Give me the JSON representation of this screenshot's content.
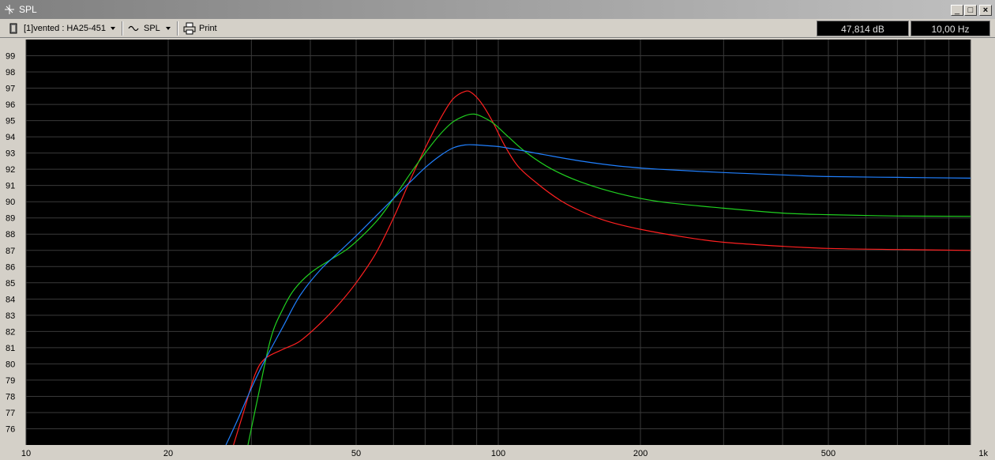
{
  "window": {
    "title": "SPL",
    "min_label": "_",
    "max_label": "□",
    "close_label": "×"
  },
  "toolbar": {
    "project_label": "[1]vented : HA25-451",
    "view_label": "SPL",
    "print_label": "Print",
    "readout_level": "47,814 dB",
    "readout_freq": "10,00 Hz"
  },
  "colors": {
    "plot_bg": "#000000",
    "grid": "#3a3a3a",
    "series_red": "#ff2020",
    "series_green": "#20d020",
    "series_blue": "#2080ff"
  },
  "chart_data": {
    "type": "line",
    "xscale": "log",
    "xlim": [
      10,
      1000
    ],
    "ylim": [
      75,
      100
    ],
    "grid": true,
    "yticks": [
      76,
      77,
      78,
      79,
      80,
      81,
      82,
      83,
      84,
      85,
      86,
      87,
      88,
      89,
      90,
      91,
      92,
      93,
      94,
      95,
      96,
      97,
      98,
      99
    ],
    "xtick_labels": [
      {
        "value": 10,
        "label": "10"
      },
      {
        "value": 20,
        "label": "20"
      },
      {
        "value": 50,
        "label": "50"
      },
      {
        "value": 100,
        "label": "100"
      },
      {
        "value": 200,
        "label": "200"
      },
      {
        "value": 500,
        "label": "500"
      },
      {
        "value": 1000,
        "label": "1k"
      }
    ],
    "series": [
      {
        "color": "#ff2020",
        "x": [
          27.5,
          29,
          30.5,
          32,
          35,
          38,
          42,
          46,
          50,
          55,
          60,
          65,
          70,
          75,
          80,
          85,
          88,
          92,
          97,
          103,
          110,
          120,
          135,
          150,
          170,
          200,
          250,
          300,
          400,
          500,
          700,
          1000
        ],
        "y": [
          75,
          77.2,
          79.3,
          80.3,
          80.9,
          81.4,
          82.5,
          83.7,
          85,
          86.8,
          89,
          91.3,
          93.3,
          95,
          96.3,
          96.8,
          96.7,
          96.1,
          95,
          93.5,
          92.2,
          91.2,
          90.1,
          89.4,
          88.8,
          88.3,
          87.8,
          87.5,
          87.25,
          87.12,
          87.05,
          87.0
        ]
      },
      {
        "color": "#20d020",
        "x": [
          29.5,
          31,
          33,
          35,
          37,
          40,
          44,
          48,
          52,
          56,
          60,
          65,
          70,
          75,
          80,
          85,
          89,
          93,
          98,
          105,
          115,
          130,
          150,
          180,
          220,
          300,
          400,
          500,
          700,
          1000
        ],
        "y": [
          75,
          78,
          81.6,
          83.4,
          84.6,
          85.6,
          86.4,
          87.1,
          88,
          89,
          90.2,
          91.7,
          93,
          94.1,
          94.9,
          95.3,
          95.4,
          95.2,
          94.8,
          94,
          93,
          92,
          91.2,
          90.5,
          90.0,
          89.6,
          89.3,
          89.2,
          89.12,
          89.1
        ]
      },
      {
        "color": "#2080ff",
        "x": [
          26.5,
          28,
          30,
          32,
          35,
          38,
          42,
          46,
          50,
          55,
          60,
          65,
          70,
          75,
          80,
          85,
          90,
          95,
          100,
          110,
          125,
          150,
          180,
          220,
          300,
          400,
          500,
          700,
          1000
        ],
        "y": [
          75,
          76.5,
          78.5,
          80.2,
          82.3,
          84.2,
          85.8,
          86.9,
          87.9,
          89.1,
          90.2,
          91.2,
          92.1,
          92.8,
          93.3,
          93.5,
          93.5,
          93.45,
          93.4,
          93.2,
          92.9,
          92.5,
          92.2,
          92.0,
          91.8,
          91.65,
          91.55,
          91.5,
          91.45
        ]
      }
    ]
  }
}
